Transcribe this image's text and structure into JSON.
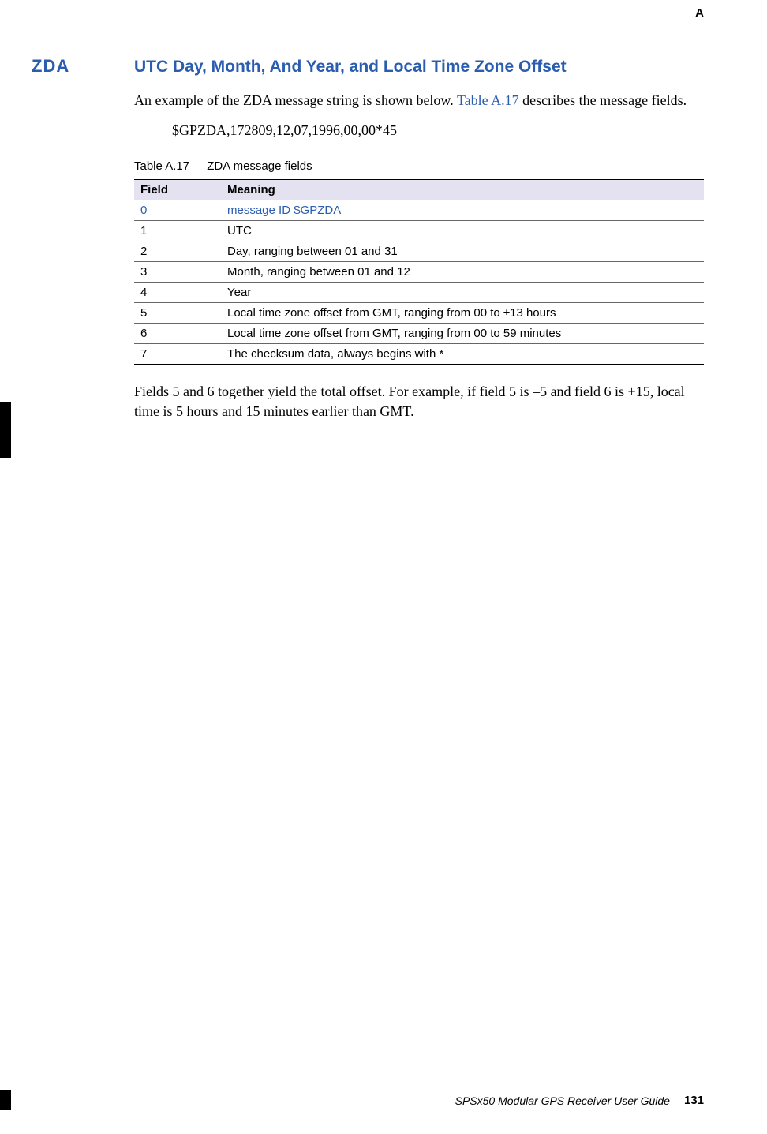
{
  "appendix_letter": "A",
  "heading_short": "ZDA",
  "heading_long": "UTC Day, Month, And Year, and Local Time Zone Offset",
  "intro_pre": "An example of the ZDA message string is shown below. ",
  "intro_link": "Table A.17",
  "intro_post": " describes the message fields.",
  "example_string": "$GPZDA,172809,12,07,1996,00,00*45",
  "table_caption_num": "Table A.17",
  "table_caption_text": "ZDA message fields",
  "table_header_field": "Field",
  "table_header_meaning": "Meaning",
  "rows": [
    {
      "field": "0",
      "meaning": "message ID $GPZDA",
      "link": true
    },
    {
      "field": "1",
      "meaning": "UTC",
      "link": false
    },
    {
      "field": "2",
      "meaning": "Day, ranging between 01 and 31",
      "link": false
    },
    {
      "field": "3",
      "meaning": "Month, ranging between 01 and 12",
      "link": false
    },
    {
      "field": "4",
      "meaning": "Year",
      "link": false
    },
    {
      "field": "5",
      "meaning": "Local time zone offset from GMT, ranging from 00 to ±13 hours",
      "link": false
    },
    {
      "field": "6",
      "meaning": "Local time zone offset from GMT, ranging from 00 to 59 minutes",
      "link": false
    },
    {
      "field": "7",
      "meaning": "The checksum data, always begins with *",
      "link": false
    }
  ],
  "post_table": "Fields 5 and 6 together yield the total offset. For example, if field 5 is –5 and field 6 is +15, local time is 5 hours and 15 minutes earlier than GMT.",
  "footer_title": "SPSx50 Modular GPS Receiver User Guide",
  "page_number": "131"
}
